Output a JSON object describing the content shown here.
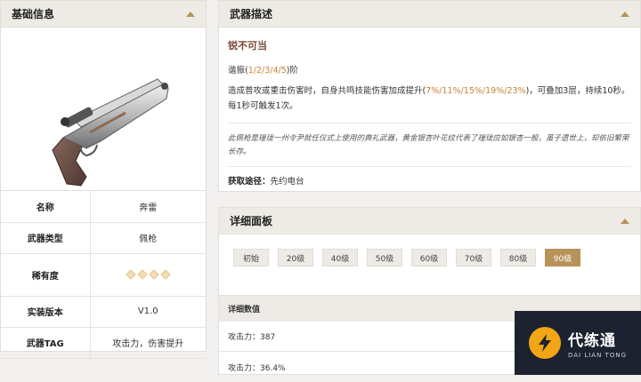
{
  "basic": {
    "title": "基础信息",
    "rows": [
      {
        "key": "名称",
        "value": "奔雷"
      },
      {
        "key": "武器类型",
        "value": "佩枪"
      },
      {
        "key": "稀有度",
        "value": ""
      },
      {
        "key": "实装版本",
        "value": "V1.0"
      },
      {
        "key": "武器TAG",
        "value": "攻击力，伤害提升"
      }
    ],
    "rarity_stars": 4
  },
  "description": {
    "title": "武器描述",
    "skill_name": "锐不可当",
    "tune_prefix": "谐振(",
    "tune_levels": "1/2/3/4/5",
    "tune_suffix": ")阶",
    "effect_a": "造成普攻或重击伤害时，自身共鸣技能伤害加成提升(",
    "effect_values": "7%/11%/15%/19%/23%",
    "effect_b": ")，可叠加3层，持续10秒。每1秒可触发1次。",
    "flavor": "此佩枪是瑝珑一州令尹就任仪式上使用的典礼武器，黄金银杏叶花纹代表了瑝珑应如银杏一般，虽子遗世上，却依旧繁荣长存。",
    "source_label": "获取途径：",
    "source_value": "先约电台"
  },
  "detail": {
    "title": "详细面板",
    "levels": [
      "初始",
      "20级",
      "40级",
      "50级",
      "60级",
      "70级",
      "80级",
      "90级"
    ],
    "active_level": "90级",
    "table_header": "详细数值",
    "stats": [
      "攻击力：387",
      "攻击力：36.4%"
    ]
  },
  "watermark": {
    "cn": "代练通",
    "en": "DAI LIAN TONG"
  },
  "colors": {
    "accent": "#b7935a",
    "highlight": "#c8823a",
    "skill_name": "#7a4a35"
  }
}
